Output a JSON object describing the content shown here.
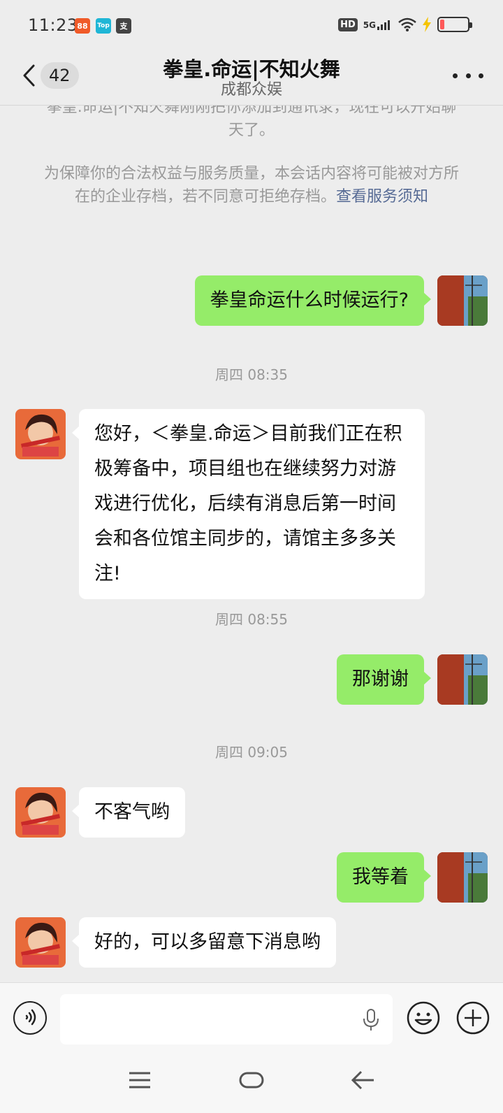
{
  "status_bar": {
    "time": "11:23",
    "apps": [
      {
        "icon": "shopping-app-icon",
        "label": "88",
        "color": "#f05a28"
      },
      {
        "icon": "top-app-icon",
        "label": "Top",
        "color": "#1fb6d6"
      },
      {
        "icon": "alipay-icon",
        "label": "支",
        "color": "#444444"
      }
    ],
    "hd": "HD",
    "network": "5G",
    "battery_level_percent": 15
  },
  "header": {
    "unread_count": "42",
    "title": "拳皇.命运|不知火舞",
    "subtitle": "成都众娱"
  },
  "notices": {
    "added_line": "拳皇.命运|不知火舞刚刚把你添加到通讯录，现在可以开始聊天了。",
    "archive_text": "为保障你的合法权益与服务质量，本会话内容将可能被对方所在的企业存档，若不同意可拒绝存档。",
    "archive_link": "查看服务须知"
  },
  "messages": [
    {
      "sender": "me",
      "text": "拳皇命运什么时候运行?"
    },
    {
      "time": "周四 08:35"
    },
    {
      "sender": "them",
      "text": "您好，＜拳皇.命运＞目前我们正在积极筹备中，项目组也在继续努力对游戏进行优化，后续有消息后第一时间会和各位馆主同步的，请馆主多多关注!"
    },
    {
      "time": "周四 08:55"
    },
    {
      "sender": "me",
      "text": "那谢谢"
    },
    {
      "time": "周四 09:05"
    },
    {
      "sender": "them",
      "text": "不客气哟"
    },
    {
      "sender": "me",
      "text": "我等着"
    },
    {
      "sender": "them",
      "text": "好的，可以多留意下消息哟"
    }
  ],
  "colors": {
    "my_bubble": "#95ec69",
    "their_bubble": "#ffffff",
    "background": "#ededed",
    "link": "#576b95"
  }
}
